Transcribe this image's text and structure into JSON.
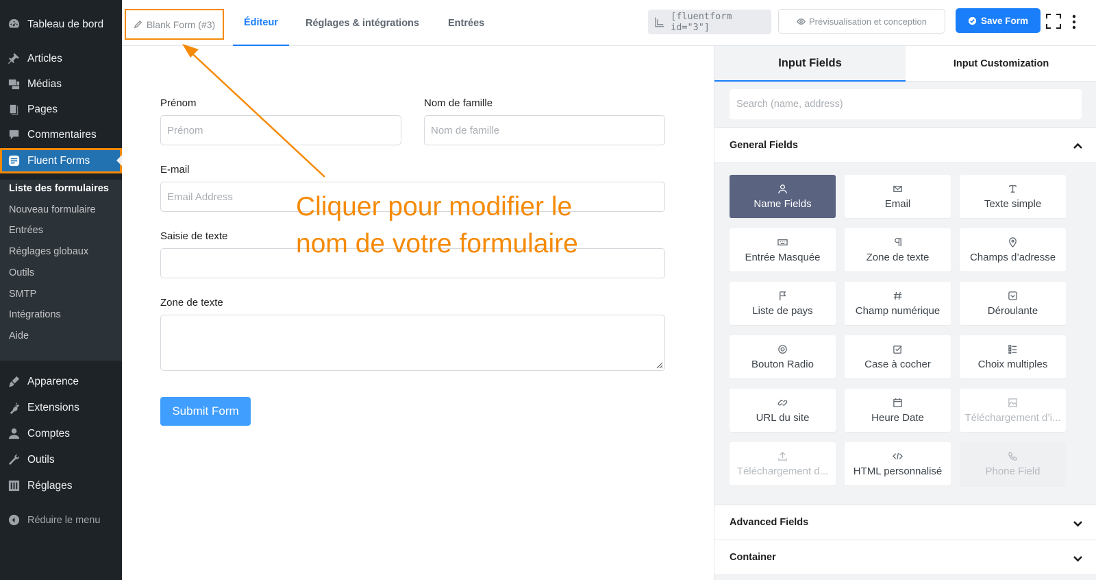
{
  "sidebar": {
    "items": [
      {
        "label": "Tableau de bord",
        "icon": "dashboard-icon"
      },
      {
        "label": "Articles",
        "icon": "pin-icon"
      },
      {
        "label": "Médias",
        "icon": "media-icon"
      },
      {
        "label": "Pages",
        "icon": "pages-icon"
      },
      {
        "label": "Commentaires",
        "icon": "comment-icon"
      },
      {
        "label": "Fluent Forms",
        "icon": "fluent-forms-icon"
      },
      {
        "label": "Apparence",
        "icon": "brush-icon"
      },
      {
        "label": "Extensions",
        "icon": "plugin-icon"
      },
      {
        "label": "Comptes",
        "icon": "user-icon"
      },
      {
        "label": "Outils",
        "icon": "wrench-icon"
      },
      {
        "label": "Réglages",
        "icon": "settings-sliders-icon"
      }
    ],
    "submenu": [
      "Liste des formulaires",
      "Nouveau formulaire",
      "Entrées",
      "Réglages globaux",
      "Outils",
      "SMTP",
      "Intégrations",
      "Aide"
    ],
    "collapse_label": "Réduire le menu"
  },
  "topbar": {
    "form_name": "Blank Form (#3)",
    "tabs": [
      "Éditeur",
      "Réglages & intégrations",
      "Entrées"
    ],
    "shortcode": "[fluentform id=\"3\"]",
    "preview_label": "Prévisualisation et conception",
    "save_label": "Save Form"
  },
  "form": {
    "first_name_label": "Prénom",
    "first_name_placeholder": "Prénom",
    "last_name_label": "Nom de famille",
    "last_name_placeholder": "Nom de famille",
    "email_label": "E-mail",
    "email_placeholder": "Email Address",
    "text_label": "Saisie de texte",
    "textarea_label": "Zone de texte",
    "submit_label": "Submit Form"
  },
  "annotation": {
    "line1": "Cliquer pour modifier le",
    "line2": "nom de votre formulaire",
    "color": "#f58a07"
  },
  "panel": {
    "tabs": [
      "Input Fields",
      "Input Customization"
    ],
    "search_placeholder": "Search (name, address)",
    "general_title": "General Fields",
    "fields": [
      {
        "label": "Name Fields",
        "icon": "user-icon"
      },
      {
        "label": "Email",
        "icon": "envelope-icon"
      },
      {
        "label": "Texte simple",
        "icon": "text-cursor-icon"
      },
      {
        "label": "Entrée Masquée",
        "icon": "keyboard-icon"
      },
      {
        "label": "Zone de texte",
        "icon": "paragraph-icon"
      },
      {
        "label": "Champs d’adresse",
        "icon": "map-pin-icon"
      },
      {
        "label": "Liste de pays",
        "icon": "flag-icon"
      },
      {
        "label": "Champ numérique",
        "icon": "hash-icon"
      },
      {
        "label": "Déroulante",
        "icon": "dropdown-icon"
      },
      {
        "label": "Bouton Radio",
        "icon": "radio-icon"
      },
      {
        "label": "Case à cocher",
        "icon": "checkbox-icon"
      },
      {
        "label": "Choix multiples",
        "icon": "list-icon"
      },
      {
        "label": "URL du site",
        "icon": "link-icon"
      },
      {
        "label": "Heure Date",
        "icon": "calendar-icon"
      },
      {
        "label": "Téléchargement d’i...",
        "icon": "image-upload-icon"
      },
      {
        "label": "Téléchargement d...",
        "icon": "upload-icon"
      },
      {
        "label": "HTML personnalisé",
        "icon": "code-icon"
      },
      {
        "label": "Phone Field",
        "icon": "phone-icon"
      }
    ],
    "advanced_title": "Advanced Fields",
    "container_title": "Container"
  },
  "colors": {
    "accent": "#1a7efb",
    "highlight": "#f58a07",
    "sidebar": "#1d2327",
    "selected_card": "#5a6380"
  }
}
